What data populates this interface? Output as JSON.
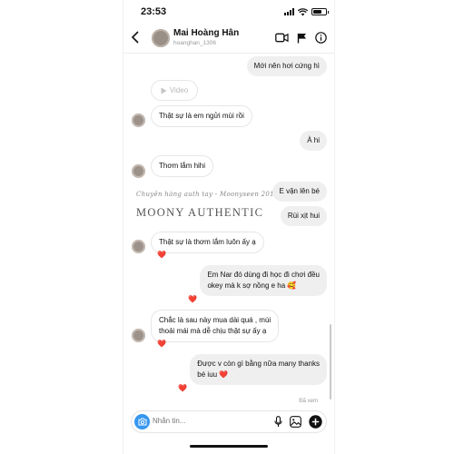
{
  "status_bar": {
    "time": "23:53"
  },
  "header": {
    "back_icon": "chevron-left-icon",
    "name": "Mai Hoàng Hân",
    "username": "hoanghan_1306",
    "icons": [
      "video-call-icon",
      "flag-icon",
      "info-icon"
    ]
  },
  "messages": [
    {
      "side": "out",
      "text": "Mới nên hơi cứng hì"
    },
    {
      "side": "in",
      "type": "video",
      "text": "Video"
    },
    {
      "side": "in",
      "text": "Thật sự là em ngửi mùi rồi"
    },
    {
      "side": "out",
      "text": "À hi"
    },
    {
      "side": "in",
      "text": "Thơm lắm hihi"
    },
    {
      "side": "out",
      "text": "E vặn lên bé"
    },
    {
      "side": "out",
      "text": "Rùi xịt hui"
    },
    {
      "side": "in",
      "text": "Thật sự là thơm lắm luôn ấy ạ",
      "reaction": "❤️"
    },
    {
      "side": "out",
      "lines": [
        "Em Nar đó dùng đi học đi chơi đều",
        "okey mà k sợ nồng e ha 🥰"
      ],
      "reaction": "❤️"
    },
    {
      "side": "in",
      "lines": [
        "Chắc là sau này mua dài quá , mùi",
        "thoải mái mà dễ chịu thật sự ấy ạ"
      ],
      "reaction": "❤️"
    },
    {
      "side": "out",
      "lines": [
        "Được v còn gì bằng nữa many thanks",
        "bé iuu ❤️"
      ],
      "reaction": "❤️"
    }
  ],
  "watermark": {
    "script": "Chuyên hàng auth tay - Moonyseen 2017",
    "title": "MOONY AUTHENTIC"
  },
  "seen_label": "Đã xem",
  "composer": {
    "placeholder": "Nhắn tin...",
    "icons": [
      "camera-icon",
      "microphone-icon",
      "gallery-icon",
      "add-icon"
    ]
  },
  "colors": {
    "accent": "#3797f0",
    "heart": "#e3262f",
    "outgoing_bubble": "#efefef"
  }
}
